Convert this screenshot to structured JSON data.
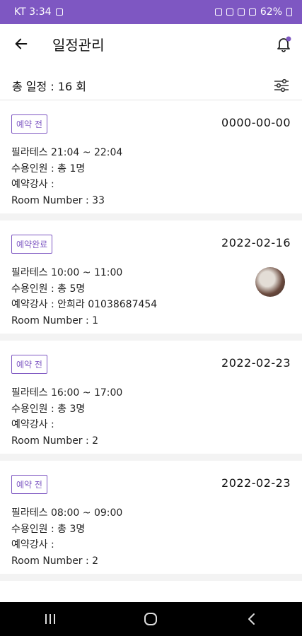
{
  "status_bar": {
    "carrier_time": "KT 3:34",
    "battery": "62%",
    "color": "#7e57c2"
  },
  "app_bar": {
    "title": "일정관리",
    "back_icon": "arrow-left",
    "bell_icon": "bell-with-dot"
  },
  "summary": {
    "text": "총 일정 : 16 회",
    "filter_icon": "sliders"
  },
  "schedules": [
    {
      "status": "예약 전",
      "date": "0000-00-00",
      "class_line": "필라테스 21:04 ~ 22:04",
      "capacity_line": "수용인원 : 총 1명",
      "instructor_line": "예약강사 :",
      "room_line": "Room Number : 33"
    },
    {
      "status": "예약완료",
      "date": "2022-02-16",
      "class_line": "필라테스 10:00 ~ 11:00",
      "capacity_line": "수용인원 : 총 5명",
      "instructor_line": "예약강사 : 안희라  01038687454",
      "room_line": "Room Number : 1"
    },
    {
      "status": "예약 전",
      "date": "2022-02-23",
      "class_line": "필라테스 16:00 ~ 17:00",
      "capacity_line": "수용인원 : 총 3명",
      "instructor_line": "예약강사 :",
      "room_line": "Room Number : 2"
    },
    {
      "status": "예약 전",
      "date": "2022-02-23",
      "class_line": "필라테스 08:00 ~ 09:00",
      "capacity_line": "수용인원 : 총 3명",
      "instructor_line": "예약강사 :",
      "room_line": "Room Number : 2"
    }
  ],
  "nav_bar": {
    "recent_icon": "recent-apps",
    "home_icon": "home",
    "back_icon": "back-chevron"
  }
}
